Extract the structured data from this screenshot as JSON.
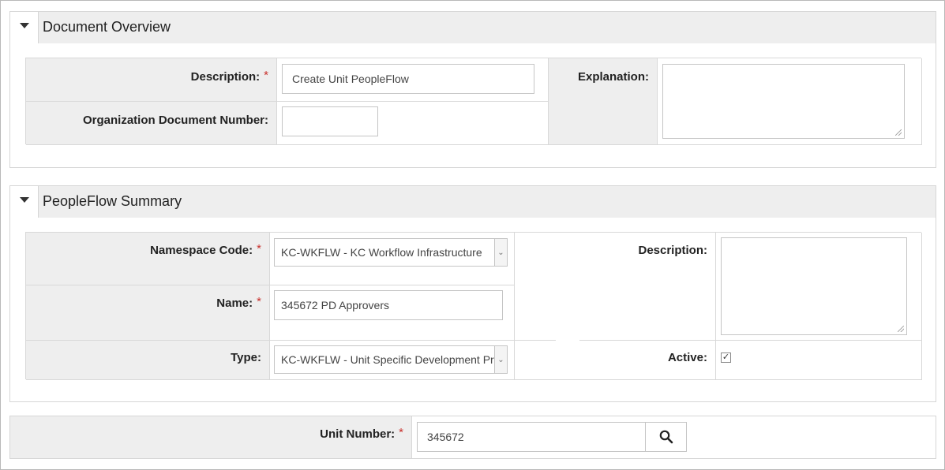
{
  "document_overview": {
    "title": "Document Overview",
    "description_label": "Description:",
    "description_value": "Create Unit PeopleFlow",
    "org_doc_number_label": "Organization Document Number:",
    "org_doc_number_value": "",
    "explanation_label": "Explanation:",
    "explanation_value": ""
  },
  "peopleflow_summary": {
    "title": "PeopleFlow Summary",
    "namespace_label": "Namespace Code:",
    "namespace_value": "KC-WKFLW - KC Workflow Infrastructure",
    "name_label": "Name:",
    "name_value": "345672 PD Approvers",
    "type_label": "Type:",
    "type_value": "KC-WKFLW - Unit Specific Development Pr",
    "description_label": "Description:",
    "description_value": "",
    "active_label": "Active:",
    "active_checked": true
  },
  "unit": {
    "unit_number_label": "Unit Number:",
    "unit_number_value": "345672"
  },
  "required_marker": "*",
  "icons": {
    "collapse": "caret-down-icon",
    "search": "search-icon",
    "check": "✓"
  }
}
